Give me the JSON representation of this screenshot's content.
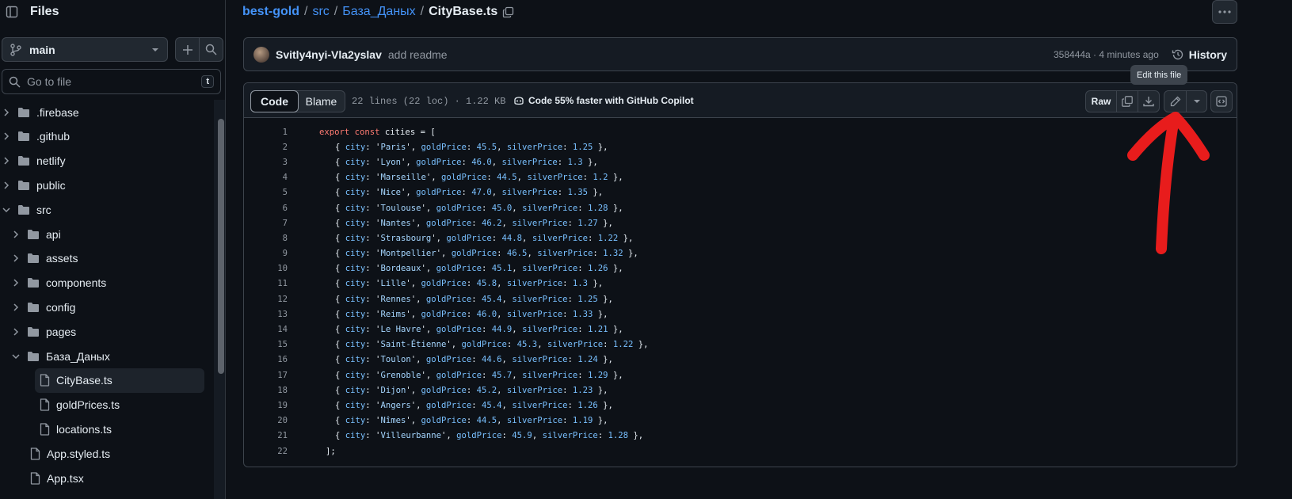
{
  "sidebar": {
    "title": "Files",
    "branch": "main",
    "goto_placeholder": "Go to file",
    "goto_shortcut": "t",
    "tree": [
      {
        "label": ".firebase",
        "type": "folder",
        "depth": 0,
        "expanded": false
      },
      {
        "label": ".github",
        "type": "folder",
        "depth": 0,
        "expanded": false
      },
      {
        "label": "netlify",
        "type": "folder",
        "depth": 0,
        "expanded": false
      },
      {
        "label": "public",
        "type": "folder",
        "depth": 0,
        "expanded": false
      },
      {
        "label": "src",
        "type": "folder",
        "depth": 0,
        "expanded": true
      },
      {
        "label": "api",
        "type": "folder",
        "depth": 1,
        "expanded": false
      },
      {
        "label": "assets",
        "type": "folder",
        "depth": 1,
        "expanded": false
      },
      {
        "label": "components",
        "type": "folder",
        "depth": 1,
        "expanded": false
      },
      {
        "label": "config",
        "type": "folder",
        "depth": 1,
        "expanded": false
      },
      {
        "label": "pages",
        "type": "folder",
        "depth": 1,
        "expanded": false
      },
      {
        "label": "База_Даных",
        "type": "folder",
        "depth": 1,
        "expanded": true
      },
      {
        "label": "CityBase.ts",
        "type": "file",
        "depth": 2,
        "active": true
      },
      {
        "label": "goldPrices.ts",
        "type": "file",
        "depth": 2
      },
      {
        "label": "locations.ts",
        "type": "file",
        "depth": 2
      },
      {
        "label": "App.styled.ts",
        "type": "file",
        "depth": 1
      },
      {
        "label": "App.tsx",
        "type": "file",
        "depth": 1
      }
    ]
  },
  "breadcrumb": {
    "repo": "best-gold",
    "sep1": "/",
    "dir1": "src",
    "sep2": "/",
    "dir2": "База_Даных",
    "sep3": "/",
    "file": "CityBase.ts"
  },
  "commit": {
    "author": "Svitly4nyi-Vla2yslav",
    "message": "add readme",
    "meta": "358444a · 4 minutes ago",
    "history_label": "History"
  },
  "tooltip": "Edit this file",
  "file_header": {
    "tab_code": "Code",
    "tab_blame": "Blame",
    "lines_info": "22 lines (22 loc) · 1.22 KB",
    "copilot": "Code 55% faster with GitHub Copilot",
    "raw_label": "Raw"
  },
  "code": {
    "first_line": "export const cities = [",
    "last_line": "];",
    "entries": [
      {
        "city": "Paris",
        "goldPrice": "45.5",
        "silverPrice": "1.25"
      },
      {
        "city": "Lyon",
        "goldPrice": "46.0",
        "silverPrice": "1.3"
      },
      {
        "city": "Marseille",
        "goldPrice": "44.5",
        "silverPrice": "1.2"
      },
      {
        "city": "Nice",
        "goldPrice": "47.0",
        "silverPrice": "1.35"
      },
      {
        "city": "Toulouse",
        "goldPrice": "45.0",
        "silverPrice": "1.28"
      },
      {
        "city": "Nantes",
        "goldPrice": "46.2",
        "silverPrice": "1.27"
      },
      {
        "city": "Strasbourg",
        "goldPrice": "44.8",
        "silverPrice": "1.22"
      },
      {
        "city": "Montpellier",
        "goldPrice": "46.5",
        "silverPrice": "1.32"
      },
      {
        "city": "Bordeaux",
        "goldPrice": "45.1",
        "silverPrice": "1.26"
      },
      {
        "city": "Lille",
        "goldPrice": "45.8",
        "silverPrice": "1.3"
      },
      {
        "city": "Rennes",
        "goldPrice": "45.4",
        "silverPrice": "1.25"
      },
      {
        "city": "Reims",
        "goldPrice": "46.0",
        "silverPrice": "1.33"
      },
      {
        "city": "Le Havre",
        "goldPrice": "44.9",
        "silverPrice": "1.21"
      },
      {
        "city": "Saint-Étienne",
        "goldPrice": "45.3",
        "silverPrice": "1.22"
      },
      {
        "city": "Toulon",
        "goldPrice": "44.6",
        "silverPrice": "1.24"
      },
      {
        "city": "Grenoble",
        "goldPrice": "45.7",
        "silverPrice": "1.29"
      },
      {
        "city": "Dijon",
        "goldPrice": "45.2",
        "silverPrice": "1.23"
      },
      {
        "city": "Angers",
        "goldPrice": "45.4",
        "silverPrice": "1.26"
      },
      {
        "city": "Nîmes",
        "goldPrice": "44.5",
        "silverPrice": "1.19"
      },
      {
        "city": "Villeurbanne",
        "goldPrice": "45.9",
        "silverPrice": "1.28"
      }
    ]
  },
  "colors": {
    "background": "#0d1117",
    "link": "#4493f8",
    "keyword": "#ff7b72",
    "string": "#a5d6ff",
    "property": "#79c0ff",
    "annotation": "#e81c1c"
  }
}
